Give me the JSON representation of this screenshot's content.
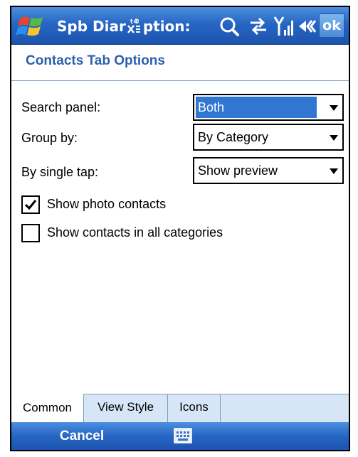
{
  "titlebar": {
    "app_title": "Spb Diar",
    "app_title_tail": "ption:",
    "ok_label": "ok",
    "icons": [
      "windows-start-icon",
      "clock-icon",
      "search-icon",
      "connectivity-icon",
      "signal-icon",
      "volume-icon"
    ]
  },
  "page": {
    "title": "Contacts Tab Options"
  },
  "form": {
    "search_panel": {
      "label": "Search panel:",
      "value": "Both"
    },
    "group_by": {
      "label": "Group by:",
      "value": "By Category"
    },
    "single_tap": {
      "label": "By single tap:",
      "value": "Show preview"
    },
    "show_photo_contacts": {
      "label": "Show photo contacts",
      "checked": true
    },
    "show_all_categories": {
      "label": "Show contacts in all categories",
      "checked": false
    }
  },
  "tabs": [
    {
      "label": "Common",
      "active": true
    },
    {
      "label": "View Style",
      "active": false
    },
    {
      "label": "Icons",
      "active": false
    }
  ],
  "menubar": {
    "cancel_label": "Cancel",
    "keyboard_icon": "keyboard-icon"
  },
  "colors": {
    "titlebar": "#2765c4",
    "accent_title": "#2d5fae",
    "selection": "#3176d0",
    "tab_strip": "#d7e6f7"
  }
}
